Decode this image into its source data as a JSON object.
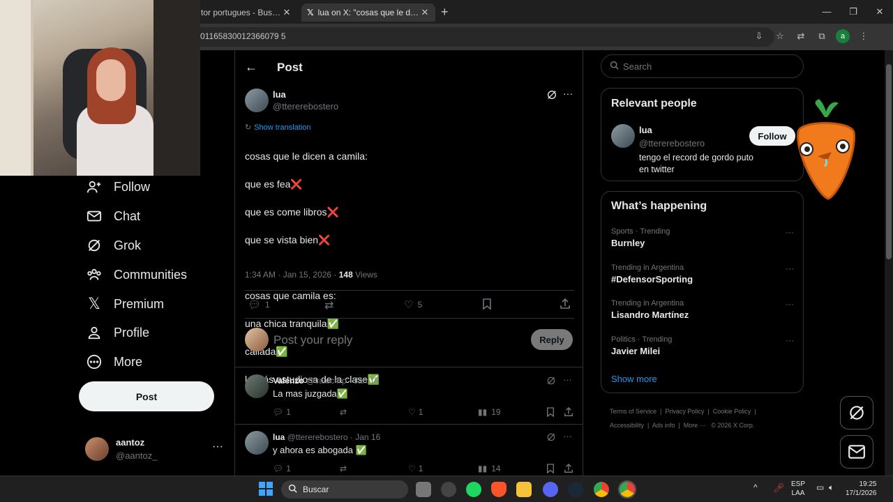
{
  "browser": {
    "tabs": [
      {
        "title": "tor portugues - Buscar con"
      },
      {
        "title": "lua on X: \"cosas que le dicen a camila\""
      }
    ],
    "url": "01165830012366079 5"
  },
  "sidebar": {
    "items": [
      {
        "label": "Follow",
        "icon": "follow-icon"
      },
      {
        "label": "Chat",
        "icon": "mail-icon"
      },
      {
        "label": "Grok",
        "icon": "grok-icon"
      },
      {
        "label": "Communities",
        "icon": "communities-icon"
      },
      {
        "label": "Premium",
        "icon": "x-logo-icon"
      },
      {
        "label": "Profile",
        "icon": "profile-icon"
      },
      {
        "label": "More",
        "icon": "more-circle-icon"
      }
    ],
    "post_button": "Post",
    "account": {
      "name": "aantoz",
      "handle": "@aantoz_",
      "more": "···"
    }
  },
  "header": {
    "title": "Post"
  },
  "tweet": {
    "name": "lua",
    "handle": "@ttererebostero",
    "show_translation": "Show translation",
    "lines": [
      "cosas que le dicen a camila:",
      "que es fea❌",
      "que es come libros❌",
      "que se vista bien❌",
      "",
      "cosas que camila es:",
      "una chica tranquila✅",
      "callada✅",
      "la más estudiosa de la clase✅"
    ],
    "timestamp": "1:34 AM · Jan 15, 2026 · ",
    "views_count": "148",
    "views_label": " Views",
    "replies": "1",
    "likes": "5"
  },
  "composer": {
    "placeholder": "Post your reply",
    "reply_button": "Reply"
  },
  "replies": [
    {
      "name": "Valenzo",
      "handle": "@valec4rp · Jan 15",
      "text": "La mas juzgada✅",
      "replies": "1",
      "likes": "1",
      "views": "19"
    },
    {
      "name": "lua",
      "handle": "@ttererebostero · Jan 16",
      "text": "y ahora es abogada ✅",
      "replies": "1",
      "likes": "1",
      "views": "14"
    }
  ],
  "search": {
    "placeholder": "Search"
  },
  "relevant_people": {
    "title": "Relevant people",
    "person": {
      "name": "lua",
      "handle": "@ttererebostero",
      "bio": "tengo el record de gordo puto en twitter",
      "follow": "Follow"
    }
  },
  "happening": {
    "title": "What’s happening",
    "trends": [
      {
        "meta": "Sports · Trending",
        "name": "Burnley"
      },
      {
        "meta": "Trending in Argentina",
        "name": "#DefensorSporting"
      },
      {
        "meta": "Trending in Argentina",
        "name": "Lisandro Martínez"
      },
      {
        "meta": "Politics · Trending",
        "name": "Javier Milei"
      }
    ],
    "show_more": "Show more"
  },
  "footer": {
    "links": [
      "Terms of Service",
      "Privacy Policy",
      "Cookie Policy",
      "Accessibility",
      "Ads info",
      "More ···"
    ],
    "copyright": "© 2026 X Corp."
  },
  "taskbar": {
    "search": "Buscar",
    "lang_top": "ESP",
    "lang_bottom": "LAA",
    "time": "19:25",
    "date": "17/1/2026"
  },
  "colors": {
    "accent": "#1d9bf0",
    "background": "#000000",
    "muted": "#71767b"
  }
}
